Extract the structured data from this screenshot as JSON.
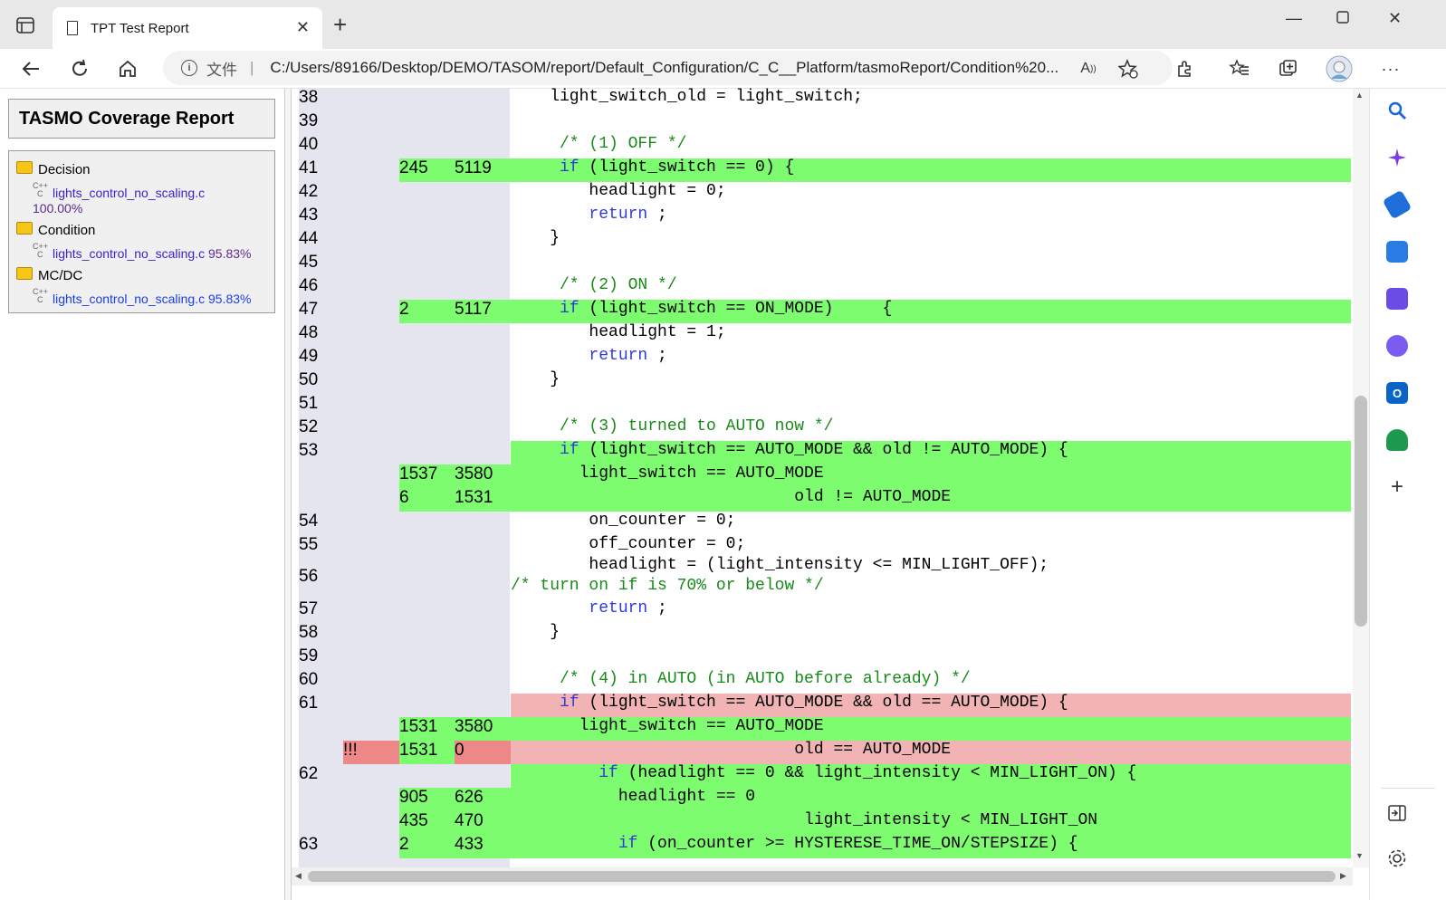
{
  "browser": {
    "tab_title": "TPT Test Report",
    "address_label": "文件",
    "url": "C:/Users/89166/Desktop/DEMO/TASOM/report/Default_Configuration/C_C__Platform/tasmoReport/Condition%20...",
    "read_aloud": "Ȃ"
  },
  "report": {
    "title": "TASMO Coverage Report",
    "tree": [
      {
        "folder": "Decision",
        "file": "lights_control_no_scaling.c",
        "pct": "100.00%"
      },
      {
        "folder": "Condition",
        "file": "lights_control_no_scaling.c",
        "pct": "95.83%"
      },
      {
        "folder": "MC/DC",
        "file": "lights_control_no_scaling.c",
        "pct": "95.83%"
      }
    ]
  },
  "code_lines": {
    "l38": {
      "ln": "38",
      "code": "    light_switch_old = light_switch;"
    },
    "l39": {
      "ln": "39"
    },
    "l40": {
      "ln": "40",
      "comment": "     /* (1) OFF */"
    },
    "l41": {
      "ln": "41",
      "c1": "245",
      "c2": "5119",
      "pre": "     ",
      "kw": "if",
      "post": " (light_switch == 0) {"
    },
    "l42": {
      "ln": "42",
      "code": "        headlight = 0;"
    },
    "l43": {
      "ln": "43",
      "pre": "        ",
      "kw": "return",
      "post": " ;"
    },
    "l44": {
      "ln": "44",
      "code": "    }"
    },
    "l45": {
      "ln": "45"
    },
    "l46": {
      "ln": "46",
      "comment": "     /* (2) ON */"
    },
    "l47": {
      "ln": "47",
      "c1": "2",
      "c2": "5117",
      "pre": "     ",
      "kw": "if",
      "post": " (light_switch == ON_MODE)     {"
    },
    "l48": {
      "ln": "48",
      "code": "        headlight = 1;"
    },
    "l49": {
      "ln": "49",
      "pre": "        ",
      "kw": "return",
      "post": " ;"
    },
    "l50": {
      "ln": "50",
      "code": "    }"
    },
    "l51": {
      "ln": "51"
    },
    "l52": {
      "ln": "52",
      "comment": "     /* (3) turned to AUTO now */"
    },
    "l53": {
      "ln": "53",
      "pre": "     ",
      "kw": "if",
      "post": " (light_switch == AUTO_MODE && old != AUTO_MODE) {"
    },
    "l53a": {
      "c1": "1537",
      "c2": "3580",
      "code": "       light_switch == AUTO_MODE"
    },
    "l53b": {
      "c1": "6",
      "c2": "1531",
      "code": "                             old != AUTO_MODE"
    },
    "l54": {
      "ln": "54",
      "code": "        on_counter = 0;"
    },
    "l55": {
      "ln": "55",
      "code": "        off_counter = 0;"
    },
    "l56": {
      "ln": "56",
      "code": "        headlight = (light_intensity <= MIN_LIGHT_OFF);",
      "comment": "/* turn on if is 70% or below */"
    },
    "l57": {
      "ln": "57",
      "pre": "        ",
      "kw": "return",
      "post": " ;"
    },
    "l58": {
      "ln": "58",
      "code": "    }"
    },
    "l59": {
      "ln": "59"
    },
    "l60": {
      "ln": "60",
      "comment": "     /* (4) in AUTO (in AUTO before already) */"
    },
    "l61": {
      "ln": "61",
      "pre": "     ",
      "kw": "if",
      "post": " (light_switch == AUTO_MODE && old == AUTO_MODE) {"
    },
    "l61a": {
      "c1": "1531",
      "c2": "3580",
      "code": "       light_switch == AUTO_MODE"
    },
    "l61b": {
      "mark": "!!!",
      "c1": "1531",
      "c2": "0",
      "code": "                             old == AUTO_MODE"
    },
    "l62": {
      "ln": "62",
      "pre": "         ",
      "kw": "if",
      "post": " (headlight == 0 && light_intensity < MIN_LIGHT_ON) {"
    },
    "l62a": {
      "c1": "905",
      "c2": "626",
      "code": "           headlight == 0"
    },
    "l62b": {
      "c1": "435",
      "c2": "470",
      "code": "                              light_intensity < MIN_LIGHT_ON"
    },
    "l63": {
      "ln": "63",
      "c1": "2",
      "c2": "433",
      "pre": "           ",
      "kw": "if",
      "post": " (on_counter >= HYSTERESE_TIME_ON/STEPSIZE) {"
    }
  }
}
